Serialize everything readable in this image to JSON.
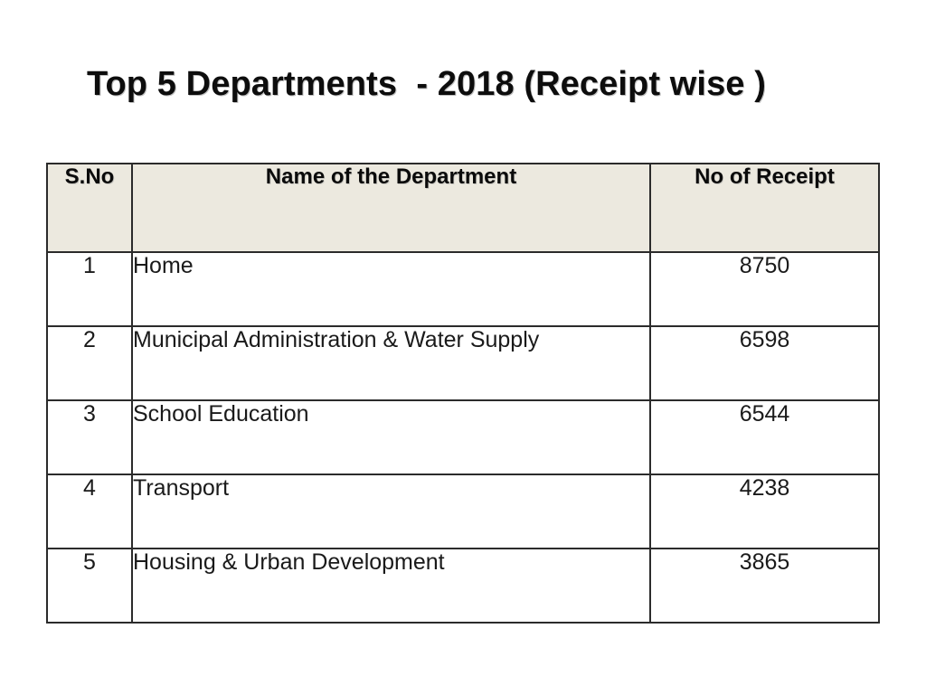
{
  "slide": {
    "title": "Top 5 Departments  - 2018 (Receipt wise )",
    "background_color": "#ffffff"
  },
  "table": {
    "header_background": "#ece9df",
    "border_color": "#2b2b2b",
    "columns": [
      {
        "key": "sno",
        "label": "S.No"
      },
      {
        "key": "name",
        "label": "Name of the Department"
      },
      {
        "key": "receipt",
        "label": "No of Receipt"
      }
    ],
    "rows": [
      {
        "sno": "1",
        "name": "Home",
        "receipt": "8750"
      },
      {
        "sno": "2",
        "name": "Municipal Administration & Water Supply",
        "receipt": "6598"
      },
      {
        "sno": "3",
        "name": "School Education",
        "receipt": "6544"
      },
      {
        "sno": "4",
        "name": "Transport",
        "receipt": "4238"
      },
      {
        "sno": "5",
        "name": "Housing & Urban Development",
        "receipt": "3865"
      }
    ]
  },
  "chart_data": {
    "type": "table",
    "title": "Top 5 Departments  - 2018 (Receipt wise )",
    "columns": [
      "S.No",
      "Name of the Department",
      "No of Receipt"
    ],
    "categories": [
      "Home",
      "Municipal Administration & Water Supply",
      "School Education",
      "Transport",
      "Housing & Urban Development"
    ],
    "values": [
      8750,
      6598,
      6544,
      4238,
      3865
    ],
    "ylabel": "No of Receipt",
    "xlabel": "Name of the Department",
    "rows": [
      [
        "1",
        "Home",
        "8750"
      ],
      [
        "2",
        "Municipal Administration & Water Supply",
        "6598"
      ],
      [
        "3",
        "School Education",
        "6544"
      ],
      [
        "4",
        "Transport",
        "4238"
      ],
      [
        "5",
        "Housing & Urban Development",
        "3865"
      ]
    ]
  }
}
